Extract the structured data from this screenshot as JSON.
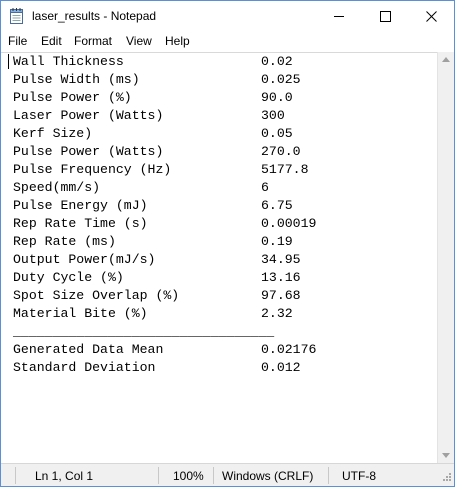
{
  "window": {
    "title": "laser_results - Notepad",
    "minimize_icon": "minimize-icon",
    "maximize_icon": "maximize-icon",
    "close_icon": "close-icon",
    "app_icon": "notepad-icon"
  },
  "menu": {
    "items": [
      "File",
      "Edit",
      "Format",
      "View",
      "Help"
    ]
  },
  "document": {
    "rows": [
      {
        "label": "Wall Thickness",
        "value": "0.02"
      },
      {
        "label": "Pulse Width (ms)",
        "value": "0.025"
      },
      {
        "label": "Pulse Power (%)",
        "value": "90.0"
      },
      {
        "label": "Laser Power (Watts)",
        "value": "300"
      },
      {
        "label": "Kerf Size)",
        "value": "0.05"
      },
      {
        "label": "Pulse Power (Watts)",
        "value": "270.0"
      },
      {
        "label": "Pulse Frequency (Hz)",
        "value": "5177.8"
      },
      {
        "label": "Speed(mm/s)",
        "value": "6"
      },
      {
        "label": "Pulse Energy (mJ)",
        "value": "6.75"
      },
      {
        "label": "Rep Rate Time (s)",
        "value": "0.00019"
      },
      {
        "label": "Rep Rate (ms)",
        "value": "0.19"
      },
      {
        "label": "Output Power(mJ/s)",
        "value": "34.95"
      },
      {
        "label": "Duty Cycle (%)",
        "value": "13.16"
      },
      {
        "label": "Spot Size Overlap (%)",
        "value": "97.68"
      },
      {
        "label": "Material Bite (%)",
        "value": "2.32"
      }
    ],
    "separator": "_________________________________",
    "summary": [
      {
        "label": "Generated Data Mean",
        "value": "0.02176"
      },
      {
        "label": "Standard Deviation",
        "value": "0.012"
      }
    ]
  },
  "status": {
    "position": "Ln 1, Col 1",
    "zoom": "100%",
    "line_endings": "Windows (CRLF)",
    "encoding": "UTF-8"
  }
}
